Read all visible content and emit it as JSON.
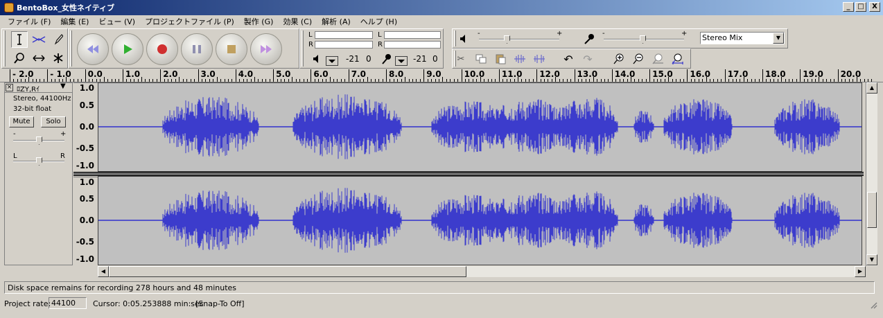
{
  "window": {
    "title": "BentoBox_女性ネイティブ",
    "min": "_",
    "max": "□",
    "close": "X"
  },
  "menu": [
    "ファイル (F)",
    "編集 (E)",
    "ビュー (V)",
    "プロジェクトファイル (P)",
    "製作 (G)",
    "効果 (C)",
    "解析 (A)",
    "ヘルプ (H)"
  ],
  "meters": {
    "out_l": "L",
    "out_r": "R",
    "in_l": "L",
    "in_r": "R",
    "out_db": "-21",
    "out_zero": "0",
    "in_db": "-21",
    "in_zero": "0"
  },
  "mixer": {
    "minus": "-",
    "plus": "+",
    "input_source": "Stereo Mix"
  },
  "ruler": {
    "labels": [
      "- 2.0",
      "- 1.0",
      "0.0",
      "1.0",
      "2.0",
      "3.0",
      "4.0",
      "5.0",
      "6.0",
      "7.0",
      "8.0",
      "9.0",
      "10.0",
      "11.0",
      "12.0",
      "13.0",
      "14.0",
      "15.0",
      "16.0",
      "17.0",
      "18.0",
      "19.0",
      "20.0"
    ]
  },
  "track": {
    "name": "ﾛZY,Rｲ",
    "info1": "Stereo, 44100Hz",
    "info2": "32-bit float",
    "mute": "Mute",
    "solo": "Solo",
    "gain_minus": "-",
    "gain_plus": "+",
    "pan_l": "L",
    "pan_r": "R",
    "scale": [
      "1.0",
      "0.5",
      "0.0",
      "-0.5",
      "-1.0"
    ]
  },
  "status": {
    "message": "Disk space remains for recording 278 hours and 48 minutes",
    "project_rate_label": "Project rate:",
    "project_rate": "44100",
    "cursor": "Cursor: 0:05.253888 min:sec",
    "snap": "[Snap-To Off]"
  },
  "colors": {
    "waveform": "#3c3ccc",
    "wave_bg": "#c0c0c0",
    "title_start": "#0a246a",
    "title_end": "#a6caf0"
  }
}
